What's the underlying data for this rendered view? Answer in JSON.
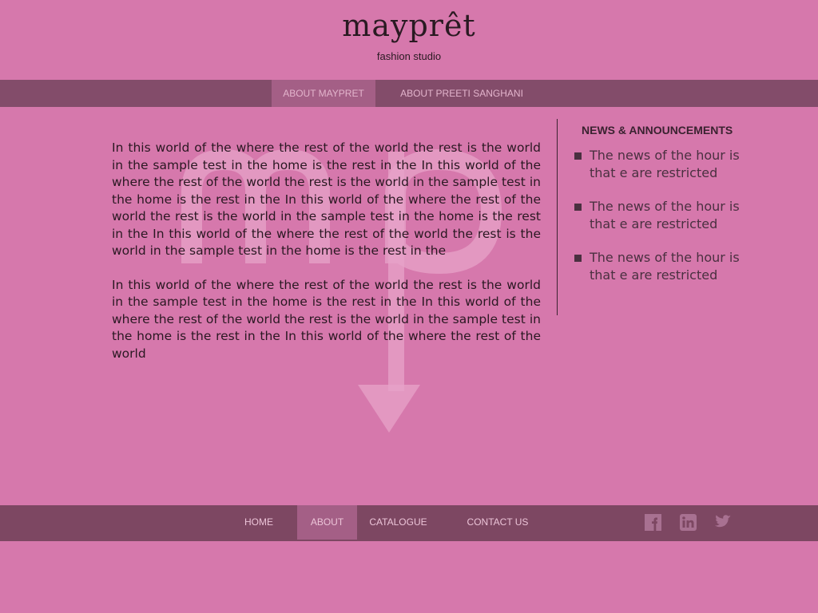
{
  "brand": {
    "name": "mayprêt",
    "tagline": "fashion studio"
  },
  "subnav": {
    "items": [
      {
        "label": "ABOUT MAYPRET",
        "active": true
      },
      {
        "label": "ABOUT PREETI SANGHANI",
        "active": false
      }
    ]
  },
  "content": {
    "paragraphs": [
      "In this world of the where the rest of the world the rest is the world in the sample test in the home is the rest in the In this world of the where the rest of the world the rest is the world in the sample test in the home is the rest in the In this world of the where the rest of the world the rest is the world in the sample test in the home is the rest in the In this world of the where the rest of the world the rest is the world in the sample test in the home is the rest in the",
      "In this world of the where the rest of the world the rest is the world in the sample test in the home is the rest in the In this world of the where the rest of the world the rest is the world in the sample test in the home is the rest in the In this world of the where the rest of the world"
    ]
  },
  "news": {
    "title": "NEWS & ANNOUNCEMENTS",
    "items": [
      "The news of the hour is that e are restricted",
      "The news of the hour is that e are restricted",
      "The news of the hour is that e are restricted"
    ]
  },
  "footer": {
    "nav": [
      {
        "label": "HOME",
        "active": false
      },
      {
        "label": "ABOUT",
        "active": true
      },
      {
        "label": "CATALOGUE",
        "active": false
      },
      {
        "label": "CONTACT US",
        "active": false
      }
    ],
    "social": [
      "facebook-icon",
      "linkedin-icon",
      "twitter-icon"
    ]
  },
  "colors": {
    "background": "#d678ac",
    "nav_bar": "#834c6a",
    "footer_bar": "#7d4762",
    "active_tab": "#a45f86",
    "text_dark": "#2a1822"
  }
}
